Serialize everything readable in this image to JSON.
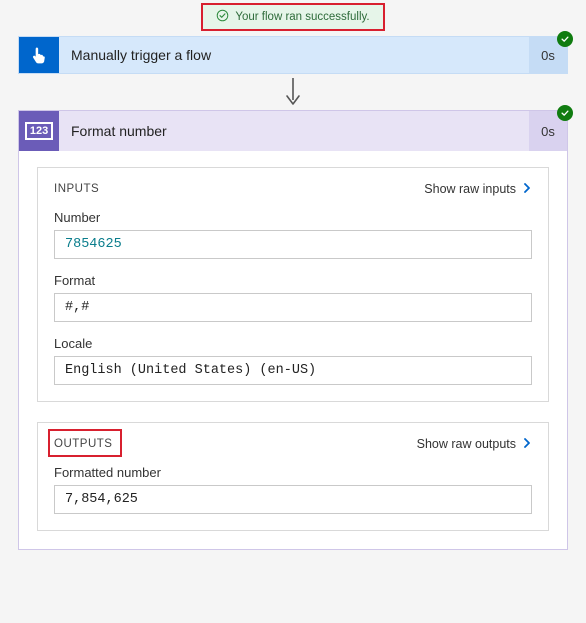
{
  "banner": {
    "text": "Your flow ran successfully."
  },
  "trigger": {
    "title": "Manually trigger a flow",
    "duration": "0s"
  },
  "action": {
    "icon_text": "123",
    "title": "Format number",
    "duration": "0s",
    "inputs": {
      "section_title": "INPUTS",
      "show_raw": "Show raw inputs",
      "fields": {
        "number_label": "Number",
        "number_value": "7854625",
        "format_label": "Format",
        "format_value": "#,#",
        "locale_label": "Locale",
        "locale_value": "English (United States) (en-US)"
      }
    },
    "outputs": {
      "section_title": "OUTPUTS",
      "show_raw": "Show raw outputs",
      "fields": {
        "formatted_label": "Formatted number",
        "formatted_value": "7,854,625"
      }
    }
  }
}
